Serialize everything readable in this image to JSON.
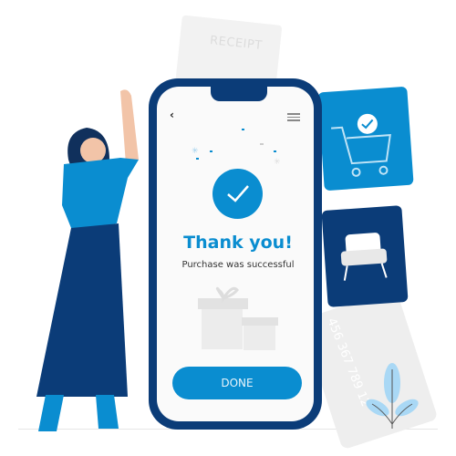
{
  "receipt": {
    "label": "RECEIPT"
  },
  "card": {
    "number": "456 367 789 12"
  },
  "phone": {
    "back_icon": "‹",
    "title": "Thank you!",
    "subtitle": "Purchase was successful",
    "done_label": "DONE"
  },
  "colors": {
    "accent": "#0a8dd0",
    "navy": "#0b3c78"
  }
}
